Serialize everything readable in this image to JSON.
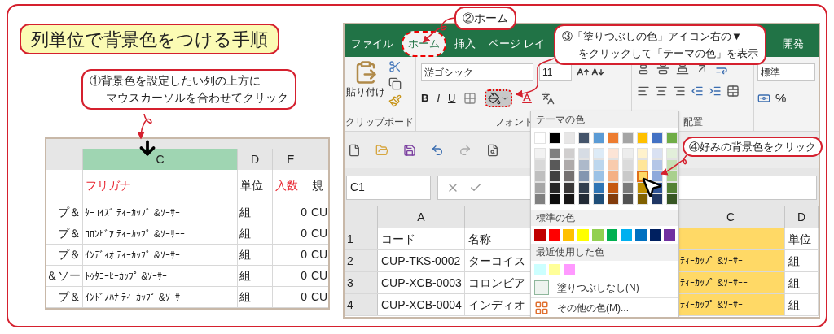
{
  "title": "列単位で背景色をつける手順",
  "callouts": [
    {
      "lines": [
        "①背景色を設定したい列の上方に",
        "マウスカーソルを合わせてクリック"
      ]
    },
    {
      "lines": [
        "②ホーム"
      ]
    },
    {
      "lines": [
        "③「塗りつぶしの色」アイコン右の▼",
        "をクリックして「テーマの色」を表示"
      ]
    },
    {
      "lines": [
        "④好みの背景色をクリック"
      ]
    }
  ],
  "left_sheet": {
    "columns": [
      {
        "label": "C",
        "selected": true
      },
      {
        "label": "D",
        "selected": false
      },
      {
        "label": "E",
        "selected": false
      }
    ],
    "header_row": [
      {
        "text": "フリガナ",
        "emphasis": true
      },
      {
        "text": "単位",
        "emphasis": false
      },
      {
        "text": "入数",
        "emphasis": true
      },
      {
        "text": "規",
        "emphasis": false
      }
    ],
    "rows": [
      {
        "stub": "プ＆",
        "cells": [
          "ﾀｰｺｲｽﾞ ﾃｨｰｶｯﾌﾟ &ｿｰｻｰ",
          "組",
          "0",
          "CU"
        ]
      },
      {
        "stub": "プ＆",
        "cells": [
          "ｺﾛﾝﾋﾞｱ ﾃｨｰｶｯﾌﾟ &ｿｰｻｰｰ",
          "組",
          "0",
          "CU"
        ]
      },
      {
        "stub": "プ＆",
        "cells": [
          "ｲﾝﾃﾞｨｵ ﾃｨｰｶｯﾌﾟ &ｿｰｻｰ",
          "組",
          "0",
          "CU"
        ]
      },
      {
        "stub": "＆ソー",
        "cells": [
          "ﾄｩﾀｺｰﾋｰｶｯﾌﾟ &ｿｰｻｰ",
          "組",
          "0",
          "CU"
        ]
      },
      {
        "stub": "プ＆",
        "cells": [
          "ｲﾝﾄﾞﾉﾊﾅ ﾃｨｰｶｯﾌﾟ &ｿｰｻｰ",
          "組",
          "0",
          "CU"
        ]
      }
    ]
  },
  "excel": {
    "tabs": [
      {
        "label": "ファイル",
        "selected": false
      },
      {
        "label": "ホーム",
        "selected": true
      },
      {
        "label": "挿入",
        "selected": false
      },
      {
        "label": "ページ レイ",
        "selected": false
      },
      {
        "label": "開発",
        "selected": false
      }
    ],
    "clipboard": {
      "paste_label": "貼り付け",
      "group_label": "クリップボード"
    },
    "font": {
      "name": "游ゴシック",
      "size": "11",
      "styles": [
        "B",
        "I",
        "U"
      ],
      "group_label": "フォント"
    },
    "alignment": {
      "group_label": "配置"
    },
    "number": {
      "format": "標準",
      "percent": "%"
    },
    "name_box": "C1",
    "grid": {
      "columns": [
        "A",
        null,
        "C",
        "D"
      ],
      "rows": [
        {
          "number": "1",
          "cells": [
            "コード",
            "名称",
            null,
            "単位"
          ]
        },
        {
          "number": "2",
          "cells": [
            "CUP-TKS-0002",
            "ターコイス",
            "ﾃｨｰｶｯﾌﾟ &ｿｰｻｰ",
            "組"
          ]
        },
        {
          "number": "3",
          "cells": [
            "CUP-XCB-0003",
            "コロンビア",
            "ﾃｨｰｶｯﾌﾟ &ｿｰｻｰｰ",
            "組"
          ]
        },
        {
          "number": "4",
          "cells": [
            "CUP-XCB-0004",
            "インディオ",
            "ﾃｨｰｶｯﾌﾟ &ｿｰｻｰ",
            "組"
          ]
        }
      ]
    },
    "palette": {
      "theme_title": "テーマの色",
      "theme": [
        {
          "swatches": [
            {
              "color": "#ffffff",
              "selected": false
            },
            {
              "color": "#f2f2f2",
              "selected": false
            },
            {
              "color": "#d9d9d9",
              "selected": false
            },
            {
              "color": "#bfbfbf",
              "selected": false
            },
            {
              "color": "#a6a6a6",
              "selected": false
            },
            {
              "color": "#808080",
              "selected": false
            }
          ]
        },
        {
          "swatches": [
            {
              "color": "#000000",
              "selected": false
            },
            {
              "color": "#7f7f7f",
              "selected": false
            },
            {
              "color": "#595959",
              "selected": false
            },
            {
              "color": "#404040",
              "selected": false
            },
            {
              "color": "#262626",
              "selected": false
            },
            {
              "color": "#0d0d0d",
              "selected": false
            }
          ]
        },
        {
          "swatches": [
            {
              "color": "#e7e6e6",
              "selected": false
            },
            {
              "color": "#d0cece",
              "selected": false
            },
            {
              "color": "#aeaaaa",
              "selected": false
            },
            {
              "color": "#757171",
              "selected": false
            },
            {
              "color": "#3a3838",
              "selected": false
            },
            {
              "color": "#171616",
              "selected": false
            }
          ]
        },
        {
          "swatches": [
            {
              "color": "#44546a",
              "selected": false
            },
            {
              "color": "#d6dce4",
              "selected": false
            },
            {
              "color": "#adb9ca",
              "selected": false
            },
            {
              "color": "#8496b0",
              "selected": false
            },
            {
              "color": "#333f4f",
              "selected": false
            },
            {
              "color": "#222a35",
              "selected": false
            }
          ]
        },
        {
          "swatches": [
            {
              "color": "#5b9bd5",
              "selected": false
            },
            {
              "color": "#ddebf7",
              "selected": false
            },
            {
              "color": "#bdd7ee",
              "selected": false
            },
            {
              "color": "#9bc2e6",
              "selected": false
            },
            {
              "color": "#2f75b5",
              "selected": false
            },
            {
              "color": "#1f4e78",
              "selected": false
            }
          ]
        },
        {
          "swatches": [
            {
              "color": "#ed7d31",
              "selected": false
            },
            {
              "color": "#fce4d6",
              "selected": false
            },
            {
              "color": "#f8cbad",
              "selected": false
            },
            {
              "color": "#f4b084",
              "selected": false
            },
            {
              "color": "#c65911",
              "selected": false
            },
            {
              "color": "#833c0c",
              "selected": false
            }
          ]
        },
        {
          "swatches": [
            {
              "color": "#a5a5a5",
              "selected": false
            },
            {
              "color": "#ededed",
              "selected": false
            },
            {
              "color": "#dbdbdb",
              "selected": false
            },
            {
              "color": "#c9c9c9",
              "selected": false
            },
            {
              "color": "#7b7b7b",
              "selected": false
            },
            {
              "color": "#525252",
              "selected": false
            }
          ]
        },
        {
          "swatches": [
            {
              "color": "#ffc000",
              "selected": false
            },
            {
              "color": "#fff2cc",
              "selected": false
            },
            {
              "color": "#ffe699",
              "selected": false
            },
            {
              "color": "#ffd966",
              "selected": true
            },
            {
              "color": "#bf8f00",
              "selected": false
            },
            {
              "color": "#806000",
              "selected": false
            }
          ]
        },
        {
          "swatches": [
            {
              "color": "#4472c4",
              "selected": false
            },
            {
              "color": "#d9e1f2",
              "selected": false
            },
            {
              "color": "#b4c6e7",
              "selected": false
            },
            {
              "color": "#8ea9db",
              "selected": false
            },
            {
              "color": "#305496",
              "selected": false
            },
            {
              "color": "#203764",
              "selected": false
            }
          ]
        },
        {
          "swatches": [
            {
              "color": "#70ad47",
              "selected": false
            },
            {
              "color": "#e2efda",
              "selected": false
            },
            {
              "color": "#c6e0b4",
              "selected": false
            },
            {
              "color": "#a9d08e",
              "selected": false
            },
            {
              "color": "#548235",
              "selected": false
            },
            {
              "color": "#375623",
              "selected": false
            }
          ]
        }
      ],
      "standard_title": "標準の色",
      "standard": [
        {
          "color": "#c00000"
        },
        {
          "color": "#ff0000"
        },
        {
          "color": "#ffc000"
        },
        {
          "color": "#ffff00"
        },
        {
          "color": "#92d050"
        },
        {
          "color": "#00b050"
        },
        {
          "color": "#00b0f0"
        },
        {
          "color": "#0070c0"
        },
        {
          "color": "#002060"
        },
        {
          "color": "#7030a0"
        }
      ],
      "recent_title": "最近使用した色",
      "recent": [
        {
          "color": "#ccffff"
        },
        {
          "color": "#ffff99"
        },
        {
          "color": "#ff99ff"
        }
      ],
      "no_fill": "塗りつぶしなし(N)",
      "more": "その他の色(M)..."
    }
  }
}
